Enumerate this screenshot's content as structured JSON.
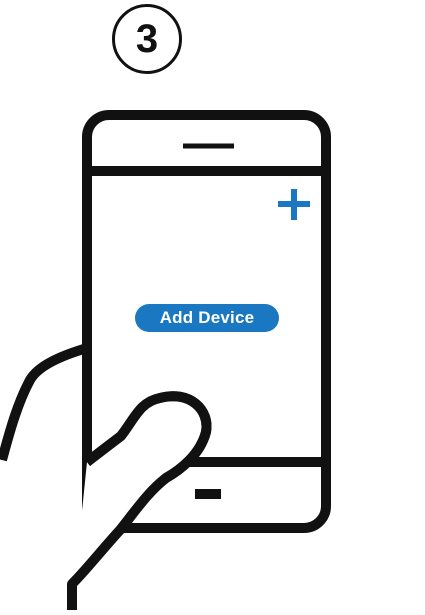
{
  "step": {
    "number": "3"
  },
  "phone_screen": {
    "add_device_label": "Add Device",
    "plus_icon": "plus-icon"
  },
  "colors": {
    "accent": "#1a78c2",
    "outline": "#111111",
    "background": "#ffffff"
  }
}
